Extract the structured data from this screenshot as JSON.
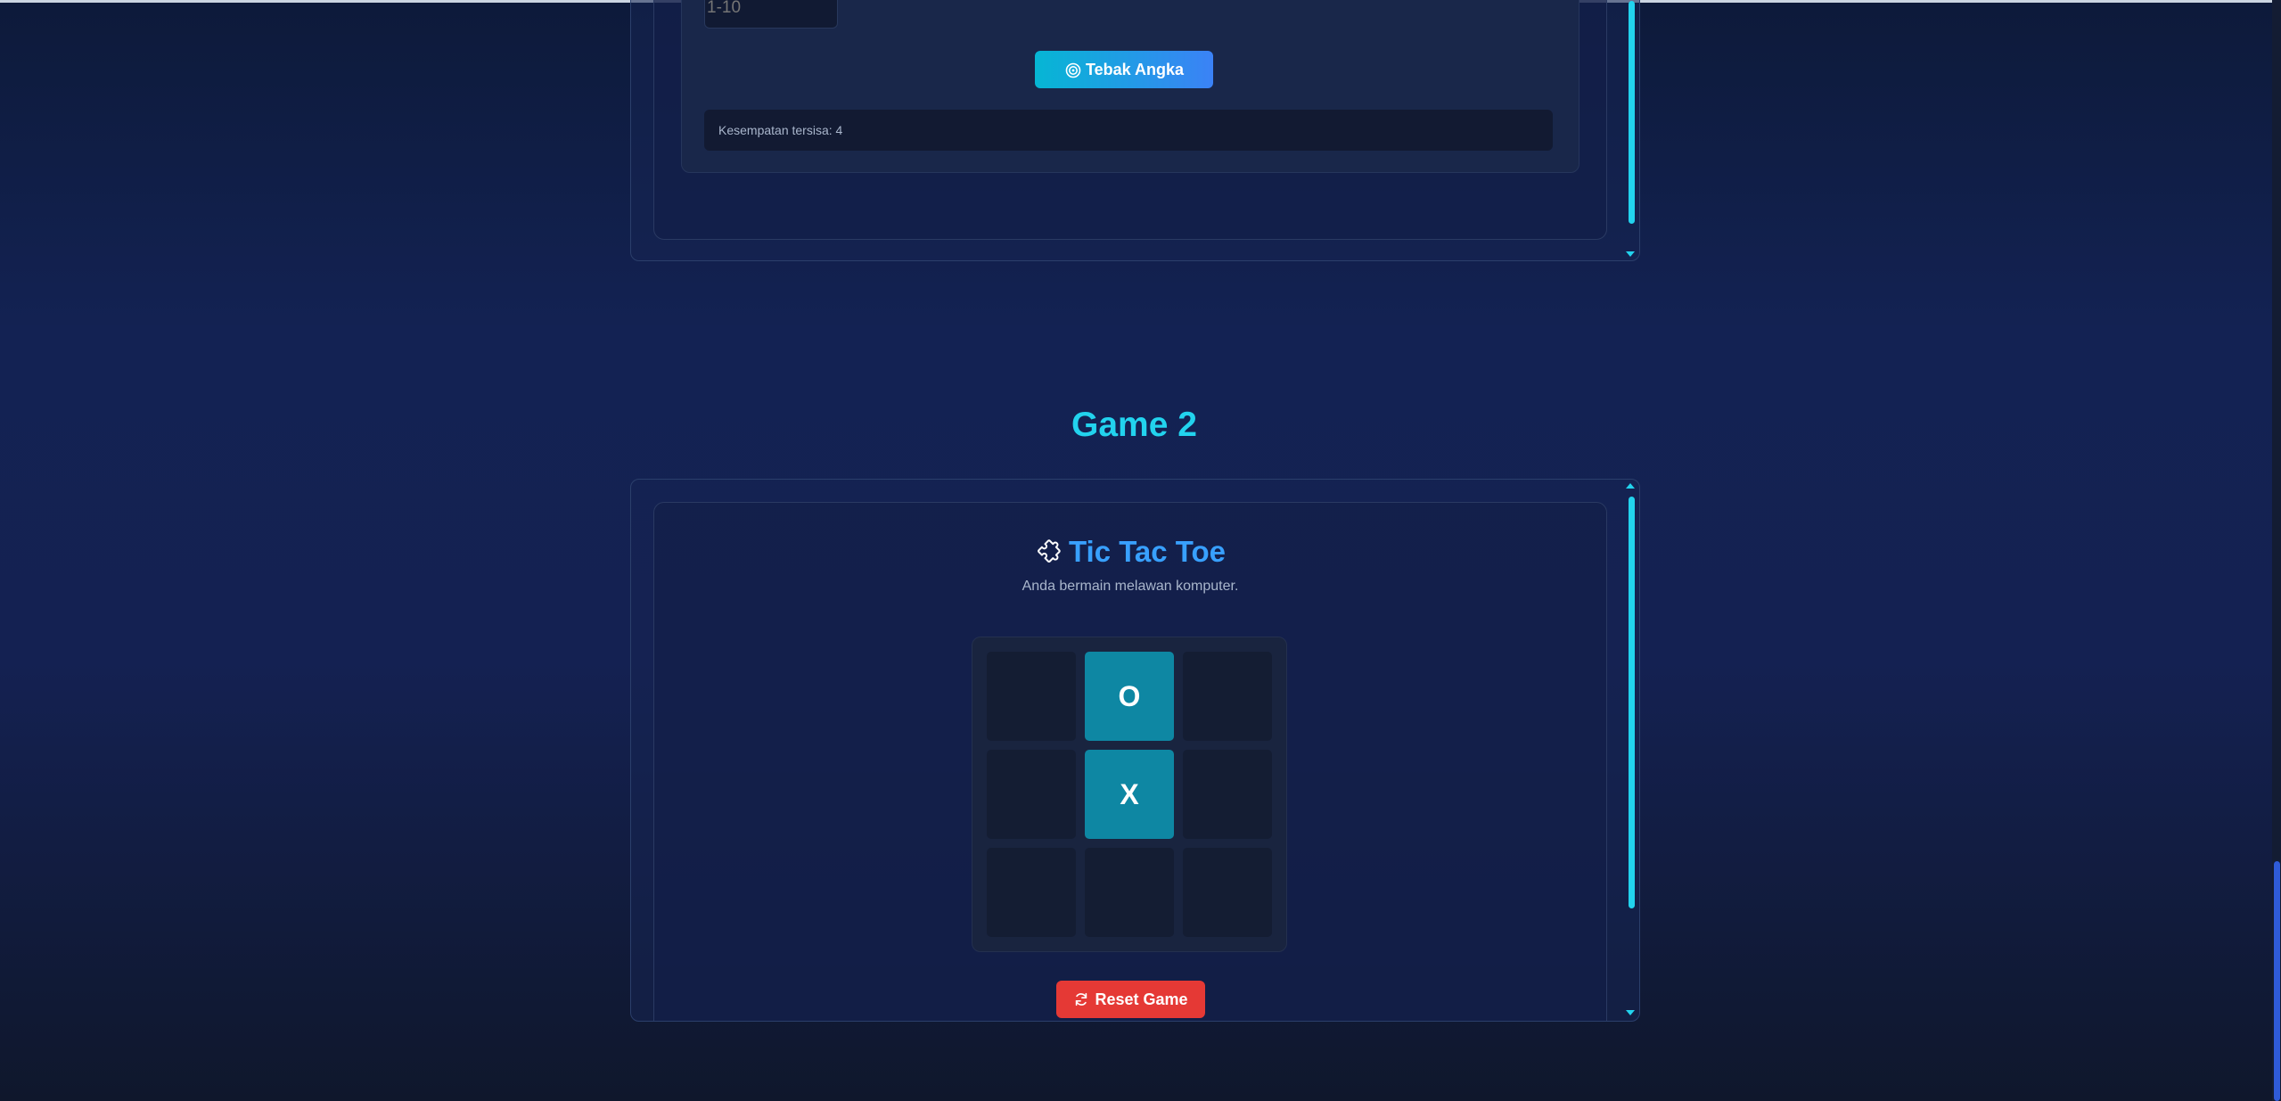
{
  "game1": {
    "input_placeholder": "1-10",
    "guess_button_label": "Tebak Angka",
    "status_text": "Kesempatan tersisa: 4"
  },
  "game2": {
    "section_title": "Game 2",
    "title": "Tic Tac Toe",
    "subtitle": "Anda bermain melawan komputer.",
    "board": [
      "",
      "O",
      "",
      "",
      "X",
      "",
      "",
      "",
      ""
    ],
    "reset_button_label": "Reset Game"
  },
  "icons": {
    "guess": "target-icon",
    "title": "puzzle-icon",
    "reset": "refresh-icon"
  },
  "colors": {
    "accent": "#22d3ee",
    "title_blue": "#38a0ff",
    "filled_cell": "#0e87a3",
    "reset_red": "#e53935"
  }
}
